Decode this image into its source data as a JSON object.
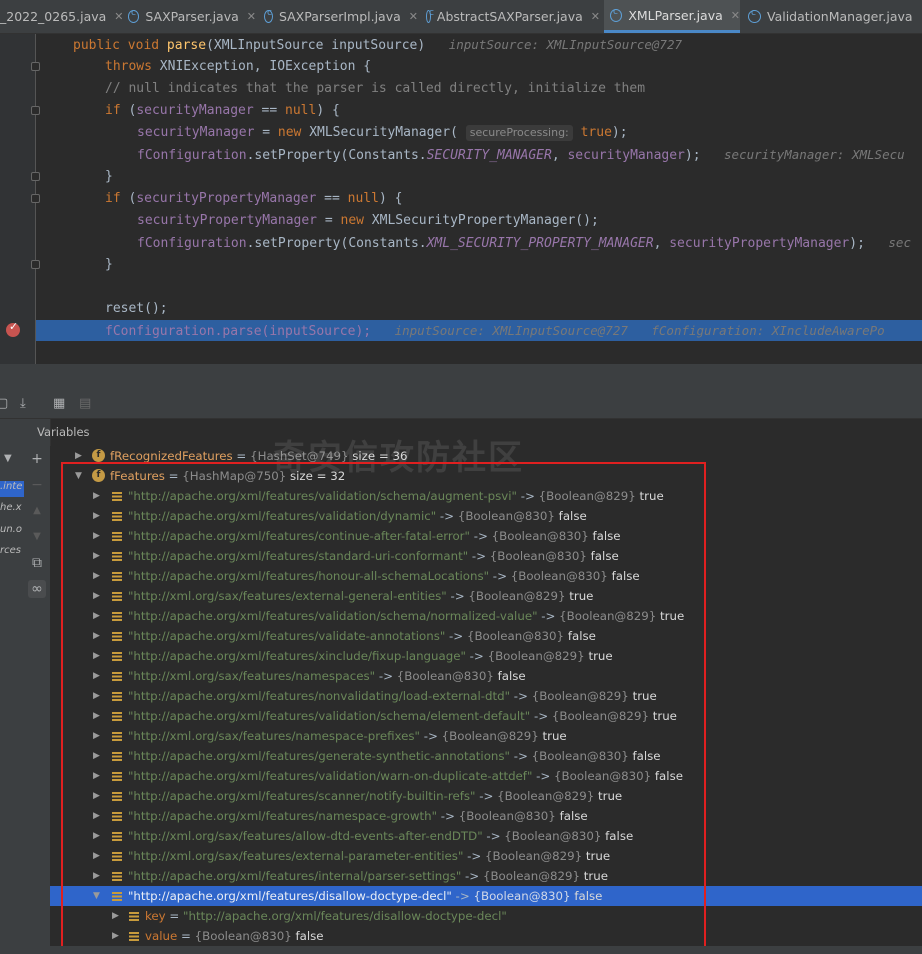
{
  "tabs": [
    {
      "label": "_2022_0265.java",
      "active": false,
      "icon": "java-class-icon"
    },
    {
      "label": "SAXParser.java",
      "active": false,
      "icon": "java-class-icon"
    },
    {
      "label": "SAXParserImpl.java",
      "active": false,
      "icon": "java-class-icon"
    },
    {
      "label": "AbstractSAXParser.java",
      "active": false,
      "icon": "java-class-icon"
    },
    {
      "label": "XMLParser.java",
      "active": true,
      "icon": "java-class-icon"
    },
    {
      "label": "ValidationManager.java",
      "active": false,
      "icon": "java-class-icon"
    }
  ],
  "code": {
    "l1_sig": "public void",
    "l1_name": "parse",
    "l1_args": "(XMLInputSource inputSource)",
    "l1_hint": "inputSource: XMLInputSource@727",
    "l2_throws": "throws",
    "l2_rest": " XNIException, IOException {",
    "l3_comment": "// null indicates that the parser is called directly, initialize them",
    "l4_if": "if",
    "l4_open": " (",
    "l4_field": "securityManager",
    "l4_eq": " == ",
    "l4_null": "null",
    "l4_close": ") {",
    "l5_field": "securityManager",
    "l5_assign": " = ",
    "l5_new": "new",
    "l5_cls": " XMLSecurityManager(",
    "l5_param": "secureProcessing:",
    "l5_true": "true",
    "l5_end": ");",
    "l6_field": "fConfiguration",
    "l6_call": ".setProperty(Constants.",
    "l6_const": "SECURITY_MANAGER",
    "l6_comma": ", ",
    "l6_arg": "securityManager",
    "l6_end": ");",
    "l6_hint": "securityManager: XMLSecu",
    "l7": "}",
    "l8_if": "if",
    "l8_open": " (",
    "l8_field": "securityPropertyManager",
    "l8_eq": " == ",
    "l8_null": "null",
    "l8_close": ") {",
    "l9_field": "securityPropertyManager",
    "l9_assign": " = ",
    "l9_new": "new",
    "l9_cls": " XMLSecurityPropertyManager();",
    "l10_field": "fConfiguration",
    "l10_call": ".setProperty(Constants.",
    "l10_const": "XML_SECURITY_PROPERTY_MANAGER",
    "l10_comma": ", ",
    "l10_arg": "securityPropertyManager",
    "l10_end": ");",
    "l10_hint": "sec",
    "l11": "}",
    "l13": "reset();",
    "l14_code": "fConfiguration.parse(inputSource);",
    "l14_hint1": "inputSource: XMLInputSource@727",
    "l14_hint2": "fConfiguration: XIncludeAwarePo"
  },
  "debug": {
    "variables_title": "Variables",
    "side_items": [
      ".inte",
      "he.x",
      "un.o",
      "rces"
    ],
    "watermark": "奇安信攻防社区"
  },
  "tree": {
    "recognized": {
      "name": "fRecognizedFeatures",
      "ref": "{HashSet@749}",
      "size": "size = 36"
    },
    "features": {
      "name": "fFeatures",
      "ref": "{HashMap@750}",
      "size": "size = 32"
    },
    "entries": [
      {
        "key": "\"http://apache.org/xml/features/validation/schema/augment-psvi\"",
        "ref": "{Boolean@829}",
        "val": "true"
      },
      {
        "key": "\"http://apache.org/xml/features/validation/dynamic\"",
        "ref": "{Boolean@830}",
        "val": "false"
      },
      {
        "key": "\"http://apache.org/xml/features/continue-after-fatal-error\"",
        "ref": "{Boolean@830}",
        "val": "false"
      },
      {
        "key": "\"http://apache.org/xml/features/standard-uri-conformant\"",
        "ref": "{Boolean@830}",
        "val": "false"
      },
      {
        "key": "\"http://apache.org/xml/features/honour-all-schemaLocations\"",
        "ref": "{Boolean@830}",
        "val": "false"
      },
      {
        "key": "\"http://xml.org/sax/features/external-general-entities\"",
        "ref": "{Boolean@829}",
        "val": "true"
      },
      {
        "key": "\"http://apache.org/xml/features/validation/schema/normalized-value\"",
        "ref": "{Boolean@829}",
        "val": "true"
      },
      {
        "key": "\"http://apache.org/xml/features/validate-annotations\"",
        "ref": "{Boolean@830}",
        "val": "false"
      },
      {
        "key": "\"http://apache.org/xml/features/xinclude/fixup-language\"",
        "ref": "{Boolean@829}",
        "val": "true"
      },
      {
        "key": "\"http://xml.org/sax/features/namespaces\"",
        "ref": "{Boolean@830}",
        "val": "false"
      },
      {
        "key": "\"http://apache.org/xml/features/nonvalidating/load-external-dtd\"",
        "ref": "{Boolean@829}",
        "val": "true"
      },
      {
        "key": "\"http://apache.org/xml/features/validation/schema/element-default\"",
        "ref": "{Boolean@829}",
        "val": "true"
      },
      {
        "key": "\"http://xml.org/sax/features/namespace-prefixes\"",
        "ref": "{Boolean@829}",
        "val": "true"
      },
      {
        "key": "\"http://apache.org/xml/features/generate-synthetic-annotations\"",
        "ref": "{Boolean@830}",
        "val": "false"
      },
      {
        "key": "\"http://apache.org/xml/features/validation/warn-on-duplicate-attdef\"",
        "ref": "{Boolean@830}",
        "val": "false"
      },
      {
        "key": "\"http://apache.org/xml/features/scanner/notify-builtin-refs\"",
        "ref": "{Boolean@829}",
        "val": "true"
      },
      {
        "key": "\"http://apache.org/xml/features/namespace-growth\"",
        "ref": "{Boolean@830}",
        "val": "false"
      },
      {
        "key": "\"http://xml.org/sax/features/allow-dtd-events-after-endDTD\"",
        "ref": "{Boolean@830}",
        "val": "false"
      },
      {
        "key": "\"http://xml.org/sax/features/external-parameter-entities\"",
        "ref": "{Boolean@829}",
        "val": "true"
      },
      {
        "key": "\"http://apache.org/xml/features/internal/parser-settings\"",
        "ref": "{Boolean@829}",
        "val": "true"
      },
      {
        "key": "\"http://apache.org/xml/features/disallow-doctype-decl\"",
        "ref": "{Boolean@830}",
        "val": "false",
        "selected": true
      }
    ],
    "child_key": {
      "name": "key",
      "eq": " = ",
      "value": "\"http://apache.org/xml/features/disallow-doctype-decl\""
    },
    "child_value": {
      "name": "value",
      "eq": " = ",
      "ref": "{Boolean@830}",
      "val": "false"
    }
  },
  "colors": {
    "highlight": "#2d5fa0",
    "selection": "#2f65ca",
    "annotation_box": "#e02020"
  }
}
